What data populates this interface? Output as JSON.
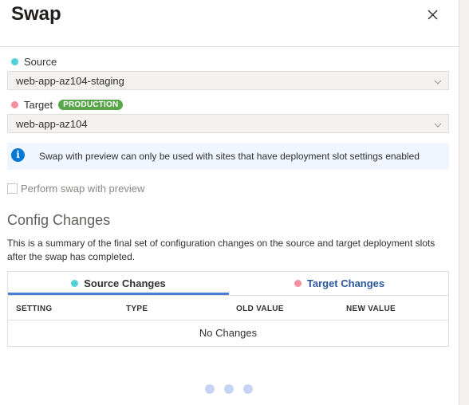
{
  "header": {
    "title": "Swap"
  },
  "source": {
    "label": "Source",
    "value": "web-app-az104-staging",
    "color": "#4fd1d9"
  },
  "target": {
    "label": "Target",
    "badge": "PRODUCTION",
    "value": "web-app-az104",
    "color": "#f4909e"
  },
  "info": {
    "text": "Swap with preview can only be used with sites that have deployment slot settings enabled"
  },
  "preview_checkbox": {
    "label": "Perform swap with preview",
    "checked": false,
    "disabled": true
  },
  "config": {
    "title": "Config Changes",
    "description": "This is a summary of the final set of configuration changes on the source and target deployment slots after the swap has completed.",
    "tabs": [
      {
        "label": "Source Changes",
        "selected": true
      },
      {
        "label": "Target Changes",
        "selected": false
      }
    ],
    "columns": [
      "SETTING",
      "TYPE",
      "OLD VALUE",
      "NEW VALUE"
    ],
    "empty_text": "No Changes"
  },
  "colors": {
    "accent": "#4a7fd6",
    "badge": "#57a64a",
    "info_icon": "#0078d4"
  }
}
